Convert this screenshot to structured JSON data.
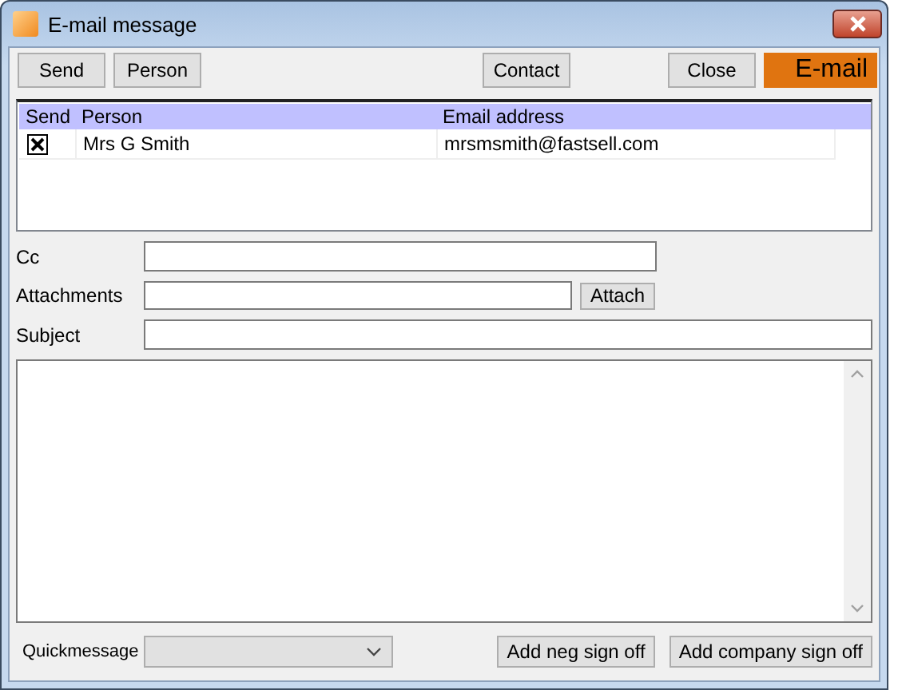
{
  "window": {
    "title": "E-mail message"
  },
  "toolbar": {
    "left_buttons": [
      "Send",
      "Person"
    ],
    "center_buttons": [
      "Contact"
    ],
    "close_button": "Close",
    "banner": "E-mail"
  },
  "recipients": {
    "columns": [
      "Send",
      "Person",
      "Email address"
    ],
    "rows": [
      {
        "checked": true,
        "person": "Mrs G Smith",
        "email": "mrsmsmith@fastsell.com"
      }
    ]
  },
  "fields": [
    {
      "kind": "short",
      "label": "Cc"
    },
    {
      "kind": "attach",
      "label": "Attachments",
      "button": "Attach"
    },
    {
      "kind": "wide",
      "label": "Subject"
    }
  ],
  "quickmessage": {
    "label": "Quickmessage",
    "disabled": true
  },
  "sign_off_buttons": [
    "Add neg sign off",
    "Add company sign off"
  ]
}
